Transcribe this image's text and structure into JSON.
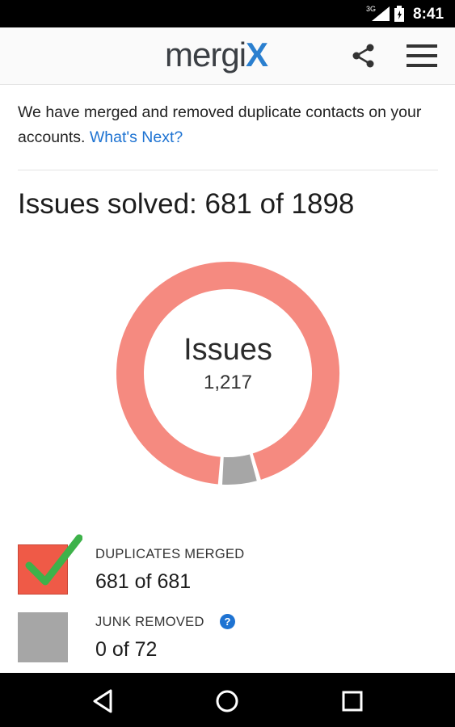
{
  "status_bar": {
    "network": "3G",
    "time": "8:41"
  },
  "app_bar": {
    "logo_text": "mergi",
    "logo_accent": "X",
    "icons": [
      "share-icon",
      "menu-icon"
    ]
  },
  "intro": {
    "text": "We have merged and removed duplicate contacts on your accounts.",
    "link": "What's Next?"
  },
  "summary": {
    "title": "Issues solved: 681 of 1898"
  },
  "chart_data": {
    "type": "pie",
    "center_label": "Issues",
    "center_value": "1,217",
    "slices": [
      {
        "name": "Remaining issues",
        "value": 1217,
        "color": "#f58a80"
      },
      {
        "name": "Junk",
        "value": 72,
        "color": "#a6a6a6"
      }
    ]
  },
  "legend": {
    "duplicates": {
      "title": "DUPLICATES MERGED",
      "value": "681 of 681",
      "color": "#ef5a47"
    },
    "junk": {
      "title": "JUNK REMOVED",
      "value": "0 of 72",
      "color": "#a6a6a6",
      "help": "?"
    }
  },
  "colors": {
    "accent_blue": "#1e73d2",
    "check_green": "#3db24a"
  }
}
